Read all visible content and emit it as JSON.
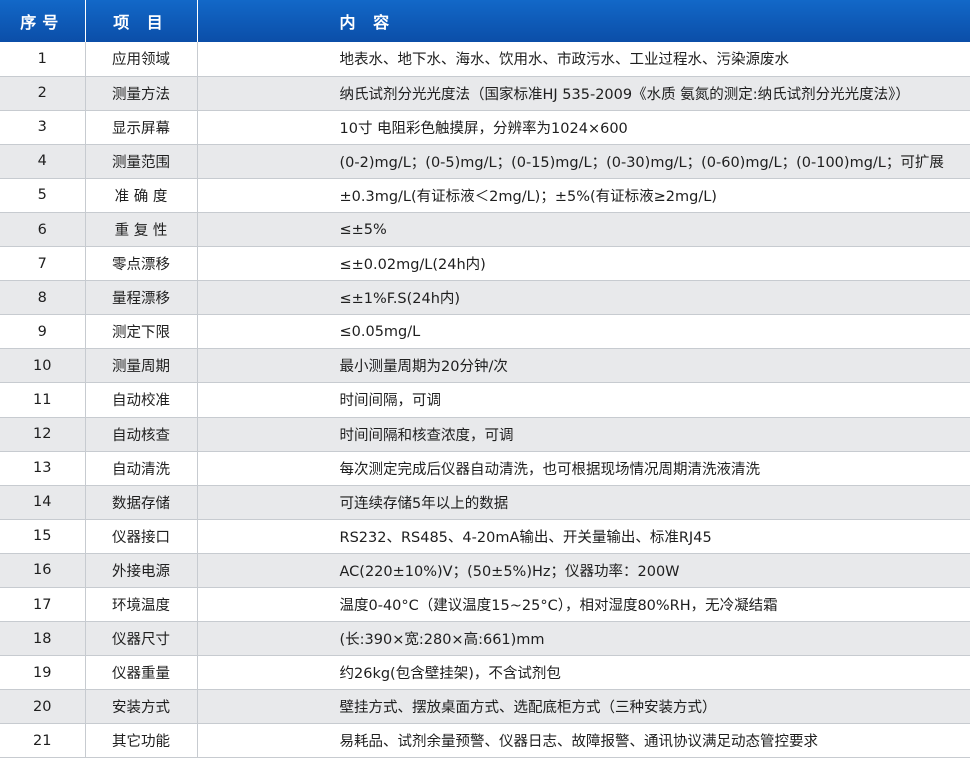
{
  "header": {
    "num": "序号",
    "item": "项 目",
    "content": "内 容"
  },
  "rows": [
    {
      "num": "1",
      "item": "应用领域",
      "content": "地表水、地下水、海水、饮用水、市政污水、工业过程水、污染源废水"
    },
    {
      "num": "2",
      "item": "测量方法",
      "content": "纳氏试剂分光光度法（国家标准HJ 535-2009《水质 氨氮的测定:纳氏试剂分光光度法》）"
    },
    {
      "num": "3",
      "item": "显示屏幕",
      "content": "10寸 电阻彩色触摸屏，分辨率为1024×600"
    },
    {
      "num": "4",
      "item": "测量范围",
      "content": "(0-2)mg/L；(0-5)mg/L；(0-15)mg/L；(0-30)mg/L；(0-60)mg/L；(0-100)mg/L；可扩展"
    },
    {
      "num": "5",
      "item": "准 确 度",
      "content": "±0.3mg/L(有证标液＜2mg/L)；±5%(有证标液≥2mg/L)"
    },
    {
      "num": "6",
      "item": "重 复 性",
      "content": "≤±5%"
    },
    {
      "num": "7",
      "item": "零点漂移",
      "content": "≤±0.02mg/L(24h内)"
    },
    {
      "num": "8",
      "item": "量程漂移",
      "content": "≤±1%F.S(24h内)"
    },
    {
      "num": "9",
      "item": "测定下限",
      "content": "≤0.05mg/L"
    },
    {
      "num": "10",
      "item": "测量周期",
      "content": "最小测量周期为20分钟/次"
    },
    {
      "num": "11",
      "item": "自动校准",
      "content": "时间间隔，可调"
    },
    {
      "num": "12",
      "item": "自动核查",
      "content": "时间间隔和核查浓度，可调"
    },
    {
      "num": "13",
      "item": "自动清洗",
      "content": "每次测定完成后仪器自动清洗，也可根据现场情况周期清洗液清洗"
    },
    {
      "num": "14",
      "item": "数据存储",
      "content": "可连续存储5年以上的数据"
    },
    {
      "num": "15",
      "item": "仪器接口",
      "content": "RS232、RS485、4-20mA输出、开关量输出、标准RJ45"
    },
    {
      "num": "16",
      "item": "外接电源",
      "content": "AC(220±10%)V；(50±5%)Hz；仪器功率：200W"
    },
    {
      "num": "17",
      "item": "环境温度",
      "content": "温度0-40°C（建议温度15~25°C），相对湿度80%RH，无冷凝结霜"
    },
    {
      "num": "18",
      "item": "仪器尺寸",
      "content": "(长:390×宽:280×高:661)mm"
    },
    {
      "num": "19",
      "item": "仪器重量",
      "content": "约26kg(包含壁挂架)，不含试剂包"
    },
    {
      "num": "20",
      "item": "安装方式",
      "content": "壁挂方式、摆放桌面方式、选配底柜方式（三种安装方式）"
    },
    {
      "num": "21",
      "item": "其它功能",
      "content": "易耗品、试剂余量预警、仪器日志、故障报警、通讯协议满足动态管控要求"
    }
  ]
}
